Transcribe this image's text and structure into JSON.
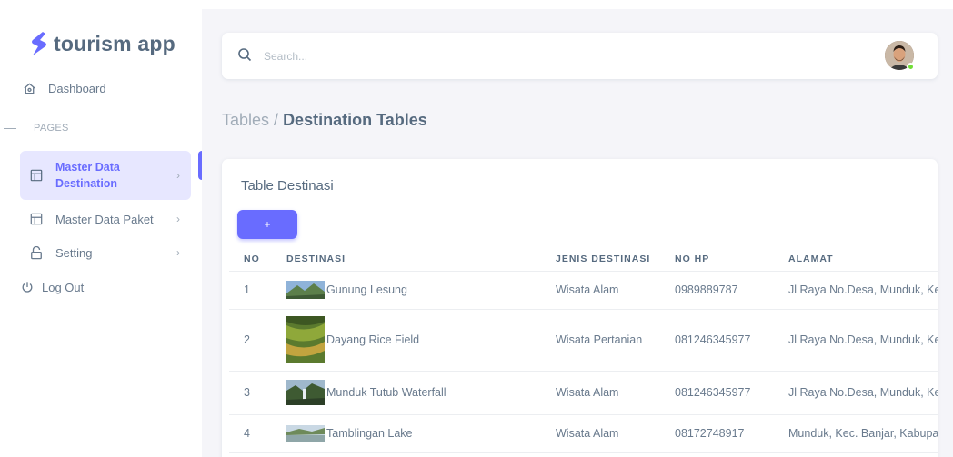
{
  "brand": {
    "name": "tourism app"
  },
  "search": {
    "placeholder": "Search..."
  },
  "sidebar": {
    "dashboard": "Dashboard",
    "section": "PAGES",
    "items": [
      {
        "label": "Master Data\nDestination",
        "icon": "layout-icon",
        "active": true
      },
      {
        "label": "Master Data Paket",
        "icon": "layout-icon"
      },
      {
        "label": "Setting",
        "icon": "lock-icon"
      },
      {
        "label": "Log Out",
        "icon": "power-icon"
      }
    ]
  },
  "breadcrumb": {
    "parent": "Tables /",
    "current": "Destination Tables"
  },
  "card": {
    "title": "Table Destinasi",
    "add_label": "+"
  },
  "table": {
    "headers": [
      "NO",
      "DESTINASI",
      "JENIS DESTINASI",
      "NO HP",
      "ALAMAT"
    ],
    "rows": [
      {
        "no": "1",
        "destinasi": "Gunung Lesung",
        "jenis": "Wisata Alam",
        "hp": "0989889787",
        "alamat": "Jl Raya No.Desa, Munduk, Ke"
      },
      {
        "no": "2",
        "destinasi": "Dayang Rice Field",
        "jenis": "Wisata Pertanian",
        "hp": "081246345977",
        "alamat": "Jl Raya No.Desa, Munduk, Ke"
      },
      {
        "no": "3",
        "destinasi": "Munduk Tutub Waterfall",
        "jenis": "Wisata Alam",
        "hp": "081246345977",
        "alamat": "Jl Raya No.Desa, Munduk, Ke"
      },
      {
        "no": "4",
        "destinasi": "Tamblingan Lake",
        "jenis": "Wisata Alam",
        "hp": "08172748917",
        "alamat": "Munduk, Kec. Banjar, Kabupa"
      }
    ]
  },
  "colors": {
    "primary": "#696cff",
    "active_bg": "#e7e7ff",
    "text": "#566a7f",
    "bg": "#f5f5f9",
    "status_online": "#71dd37"
  }
}
